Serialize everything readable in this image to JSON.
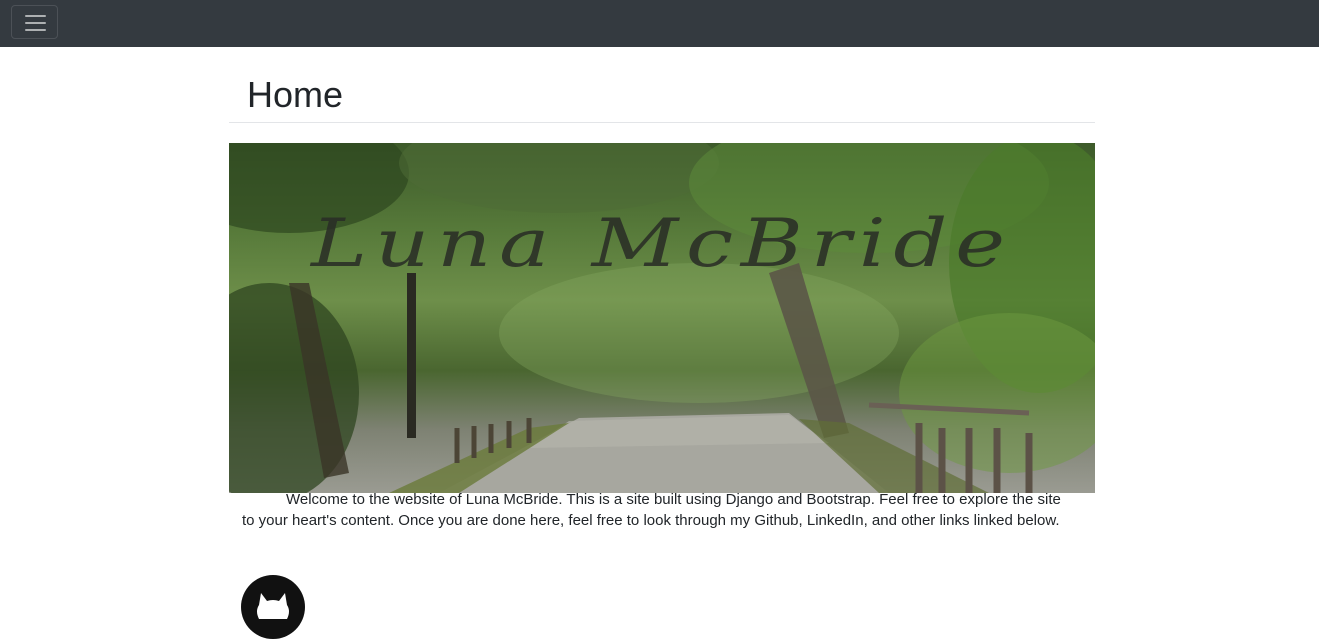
{
  "navbar": {
    "toggler_icon": "hamburger-menu-icon",
    "background": "#343a40"
  },
  "page": {
    "title": "Home"
  },
  "hero": {
    "overlay_text": "Luna McBride"
  },
  "content": {
    "welcome": "Welcome to the website of Luna McBride. This is a site built using Django and Bootstrap. Feel free to explore the site to your heart's content. Once you are done here, feel free to look through my Github, LinkedIn, and other links linked below."
  },
  "links": {
    "github_icon": "github-icon"
  }
}
